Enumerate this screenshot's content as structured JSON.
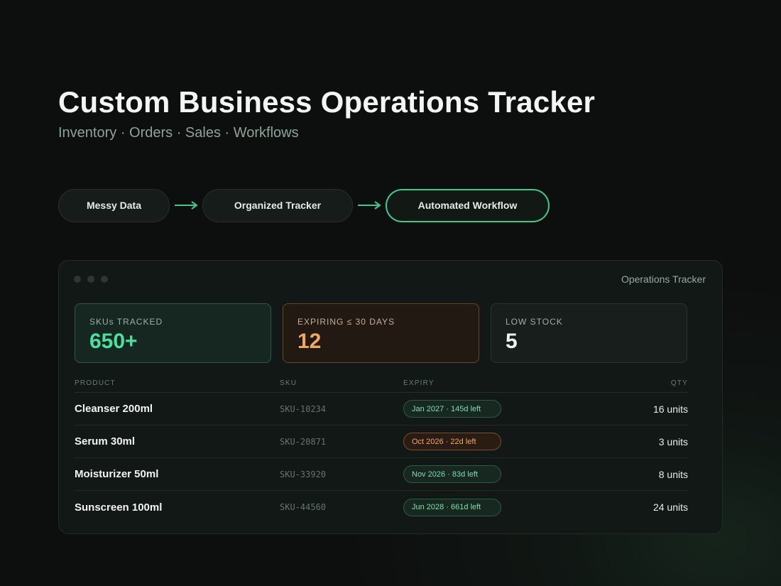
{
  "hero": {
    "title": "Custom Business Operations Tracker",
    "subtitle": "Inventory · Orders · Sales · Workflows"
  },
  "flow": {
    "steps": [
      {
        "label": "Messy Data"
      },
      {
        "label": "Organized Tracker"
      },
      {
        "label": "Automated Workflow"
      }
    ],
    "active_step": 3,
    "accent_color": "#3ec98a"
  },
  "tracker": {
    "window_title": "Operations Tracker",
    "stats": [
      {
        "label": "SKUs TRACKED",
        "value": "650+",
        "color": "#4be09b"
      },
      {
        "label": "EXPIRING ≤ 30 DAYS",
        "value": "12",
        "color": "#f0a764"
      },
      {
        "label": "LOW STOCK",
        "value": "5",
        "color": "#eef2f0"
      }
    ],
    "columns": [
      "PRODUCT",
      "SKU",
      "EXPIRY",
      "QTY"
    ],
    "rows": [
      {
        "product": "Cleanser 200ml",
        "sku": "SKU-10234",
        "expiry": "Jan 2027 · 145d left",
        "status": "ok",
        "qty": "16 units"
      },
      {
        "product": "Serum 30ml",
        "sku": "SKU-20871",
        "expiry": "Oct 2026 · 22d left",
        "status": "warn",
        "qty": "3 units"
      },
      {
        "product": "Moisturizer 50ml",
        "sku": "SKU-33920",
        "expiry": "Nov 2026 · 83d left",
        "status": "ok",
        "qty": "8 units"
      },
      {
        "product": "Sunscreen 100ml",
        "sku": "SKU-44560",
        "expiry": "Jun 2028 · 661d left",
        "status": "ok",
        "qty": "24 units"
      }
    ]
  }
}
